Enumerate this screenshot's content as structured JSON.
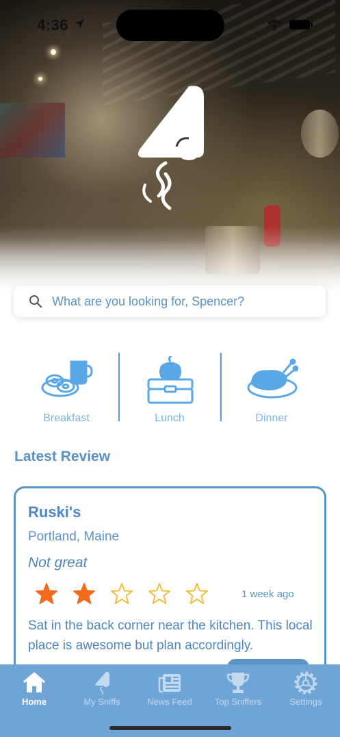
{
  "status_bar": {
    "time": "4:36"
  },
  "search": {
    "placeholder": "What are you looking for, Spencer?"
  },
  "meals": [
    {
      "label": "Breakfast",
      "icon": "coffee-donut-icon"
    },
    {
      "label": "Lunch",
      "icon": "lunchbox-apple-icon"
    },
    {
      "label": "Dinner",
      "icon": "roast-chicken-icon"
    }
  ],
  "latest_review": {
    "section_title": "Latest Review",
    "restaurant": "Ruski's",
    "location": "Portland, Maine",
    "verdict": "Not great",
    "rating": 2,
    "max_rating": 5,
    "time_ago": "1 week ago",
    "body": "Sat in the back corner near the kitchen. This local place is awesome but plan accordingly."
  },
  "tabs": [
    {
      "label": "Home",
      "icon": "home-icon",
      "active": true
    },
    {
      "label": "My Sniffs",
      "icon": "nose-icon",
      "active": false
    },
    {
      "label": "News Feed",
      "icon": "newspaper-icon",
      "active": false
    },
    {
      "label": "Top Sniffers",
      "icon": "trophy-icon",
      "active": false
    },
    {
      "label": "Settings",
      "icon": "gear-icon",
      "active": false
    }
  ],
  "colors": {
    "accent": "#5a90c2",
    "tabbar": "#6fa5d6",
    "star_filled": "#f26a1b",
    "star_empty": "#f5b82e"
  }
}
